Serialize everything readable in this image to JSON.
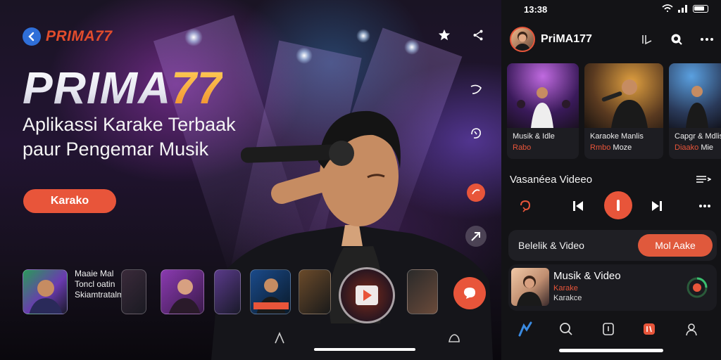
{
  "hero": {
    "brand_name": "PRIMA77",
    "title_main": "PRIMA",
    "title_accent": "77",
    "subtitle_line1": "Aplikassi Karake Terbaak",
    "subtitle_line2": "paur Pengemar Musik",
    "cta_label": "Karako",
    "thumb_text_line1": "Maaie Mal",
    "thumb_text_line2": "Toncl oatin",
    "thumb_text_line3": "Skiamtratalm",
    "icons": [
      "back-icon",
      "star-icon",
      "share-icon",
      "music-note-icon",
      "microphone-icon",
      "record-icon",
      "arrow-icon",
      "chat-icon",
      "play-icon"
    ]
  },
  "phone": {
    "status": {
      "time": "13:38"
    },
    "profile_name": "PriMA177",
    "cards": [
      {
        "line1": "Musik & Idle",
        "line2": "Rabo",
        "line2b": ""
      },
      {
        "line1": "Karaoke Manlis",
        "line2": "Rmbo",
        "line2b": "Moze"
      },
      {
        "line1": "Capgr & Mdlis",
        "line2": "Diaako",
        "line2b": "Mie"
      }
    ],
    "section_title": "Vasanéea Videeo",
    "pill_label": "Belelik & Video",
    "pill_button": "Mol Aake",
    "track": {
      "title": "Musik & Video",
      "sub1": "Karake",
      "sub2": "Karakce"
    }
  },
  "colors": {
    "accent": "#e8553a",
    "brand_blue": "#2f6fd8",
    "panel_bg": "#131316"
  }
}
